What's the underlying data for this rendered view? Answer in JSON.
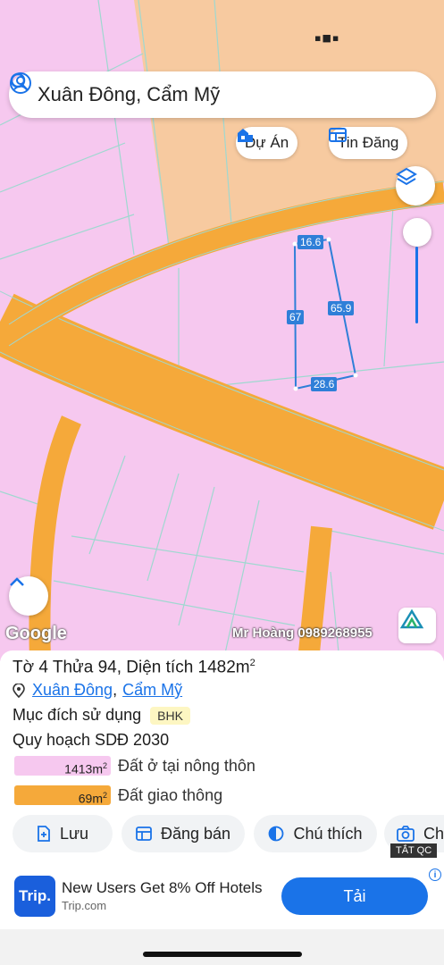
{
  "map": {
    "search_query": "Xuân Đông, Cẩm Mỹ",
    "chips": {
      "projects": "Dự Án",
      "listings": "Tin Đăng"
    },
    "dimensions": {
      "top": "16.6",
      "left": "67",
      "right": "65.9",
      "bottom": "28.6"
    },
    "google_label": "Google",
    "watermark": "Mr Hoàng 0989268955",
    "colors": {
      "residential": "#f6c8ef",
      "road": "#f5a93a",
      "upper_zone": "#f7caa0",
      "dim_label": "#2f7fd8"
    }
  },
  "parcel": {
    "title_prefix": "Tờ 4 Thửa 94, Diện tích 1482m",
    "title_sup": "2",
    "location": {
      "commune": "Xuân Đông",
      "district": "Cẩm Mỹ"
    },
    "purpose_label": "Mục đích sử dụng",
    "purpose_code": "BHK",
    "plan_label": "Quy hoạch SDĐ 2030",
    "legend": [
      {
        "area": "1413m",
        "sup": "2",
        "label": "Đất ở tại nông thôn",
        "color": "#f6c8ef"
      },
      {
        "area": "69m",
        "sup": "2",
        "label": "Đất giao thông",
        "color": "#f5a93a"
      }
    ]
  },
  "actions": {
    "save": "Lưu",
    "post": "Đăng bán",
    "legend": "Chú thích",
    "capture": "Ch"
  },
  "ad": {
    "close_label": "TẮT QC",
    "logo_text": "Trip.",
    "title": "New Users Get 8% Off Hotels",
    "subtitle": "Trip.com",
    "cta": "Tải",
    "info": "i"
  }
}
